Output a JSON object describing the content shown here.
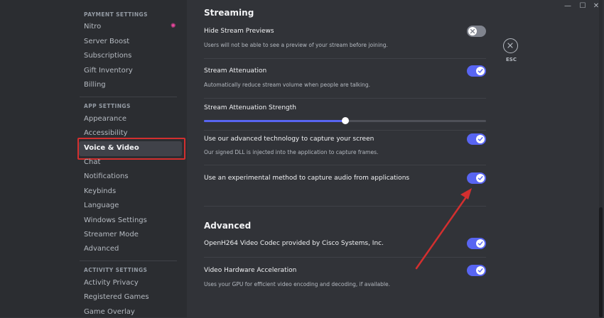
{
  "sidebar": {
    "payment_header": "PAYMENT SETTINGS",
    "payment_items": [
      {
        "label": "Nitro"
      },
      {
        "label": "Server Boost"
      },
      {
        "label": "Subscriptions"
      },
      {
        "label": "Gift Inventory"
      },
      {
        "label": "Billing"
      }
    ],
    "app_header": "APP SETTINGS",
    "app_items": [
      {
        "label": "Appearance"
      },
      {
        "label": "Accessibility"
      },
      {
        "label": "Voice & Video"
      },
      {
        "label": "Chat"
      },
      {
        "label": "Notifications"
      },
      {
        "label": "Keybinds"
      },
      {
        "label": "Language"
      },
      {
        "label": "Windows Settings"
      },
      {
        "label": "Streamer Mode"
      },
      {
        "label": "Advanced"
      }
    ],
    "activity_header": "ACTIVITY SETTINGS",
    "activity_items": [
      {
        "label": "Activity Privacy"
      },
      {
        "label": "Registered Games"
      },
      {
        "label": "Game Overlay"
      }
    ],
    "active_item": "Voice & Video"
  },
  "main": {
    "streaming_title": "Streaming",
    "options": [
      {
        "title": "Hide Stream Previews",
        "desc": "Users will not be able to see a preview of your stream before joining.",
        "enabled": false
      },
      {
        "title": "Stream Attenuation",
        "desc": "Automatically reduce stream volume when people are talking.",
        "enabled": true
      },
      {
        "title": "Use our advanced technology to capture your screen",
        "desc": "Our signed DLL is injected into the application to capture frames.",
        "enabled": true
      },
      {
        "title": "Use an experimental method to capture audio from applications",
        "desc": "",
        "enabled": true
      }
    ],
    "attenuation_strength": {
      "label": "Stream Attenuation Strength",
      "value_fraction": 0.5
    },
    "advanced_title": "Advanced",
    "advanced_options": [
      {
        "title": "OpenH264 Video Codec provided by Cisco Systems, Inc.",
        "desc": "",
        "enabled": true
      },
      {
        "title": "Video Hardware Acceleration",
        "desc": "Uses your GPU for efficient video encoding and decoding, if available.",
        "enabled": true
      }
    ]
  },
  "esc": {
    "label": "ESC"
  },
  "window_controls": {
    "minimize": "—",
    "maximize": "☐",
    "close": "✕"
  },
  "colors": {
    "accent": "#5865f2",
    "highlight": "#d32f2f",
    "nitro": "#eb459e"
  },
  "icons": [
    "nitro-icon",
    "check-icon",
    "x-icon",
    "close-icon"
  ]
}
